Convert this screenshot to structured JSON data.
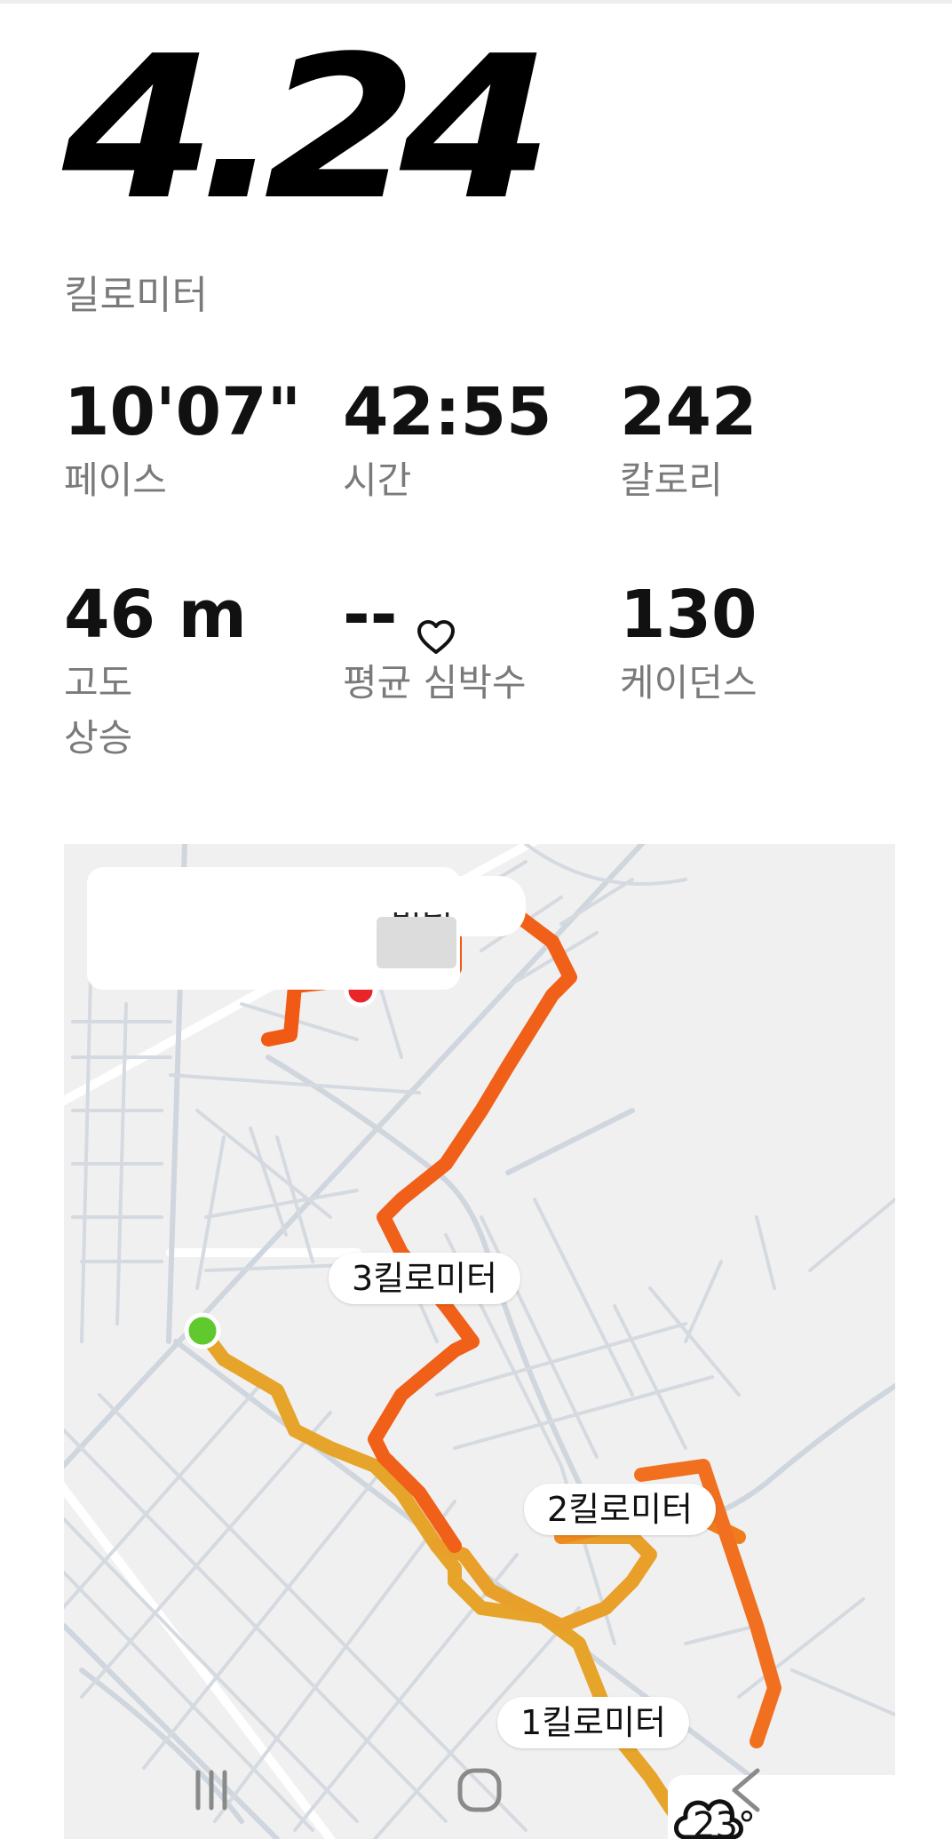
{
  "summary": {
    "distance_value": "4.24",
    "distance_unit": "킬로미터"
  },
  "stats": [
    {
      "value": "10'07\"",
      "label": "페이스"
    },
    {
      "value": "42:55",
      "label": "시간"
    },
    {
      "value": "242",
      "label": "칼로리"
    },
    {
      "value": "46 m",
      "label": "고도\n상승"
    },
    {
      "value": "--",
      "label": "평균 심박수",
      "icon": "heart-outline-icon"
    },
    {
      "value": "130",
      "label": "케이던스"
    }
  ],
  "map": {
    "route_gradient": [
      "#e6b830",
      "#ef8a1f",
      "#f06010"
    ],
    "start_marker_color": "#5fc92e",
    "end_marker_color": "#e8262a",
    "km_markers": [
      "1킬로미터",
      "2킬로미터",
      "3킬로미터"
    ],
    "partial_label": "미터",
    "weather": {
      "temperature": "23°",
      "icon": "cloud-icon"
    }
  },
  "navbar": {
    "icons": [
      "recent-apps-icon",
      "home-icon",
      "back-icon"
    ]
  }
}
